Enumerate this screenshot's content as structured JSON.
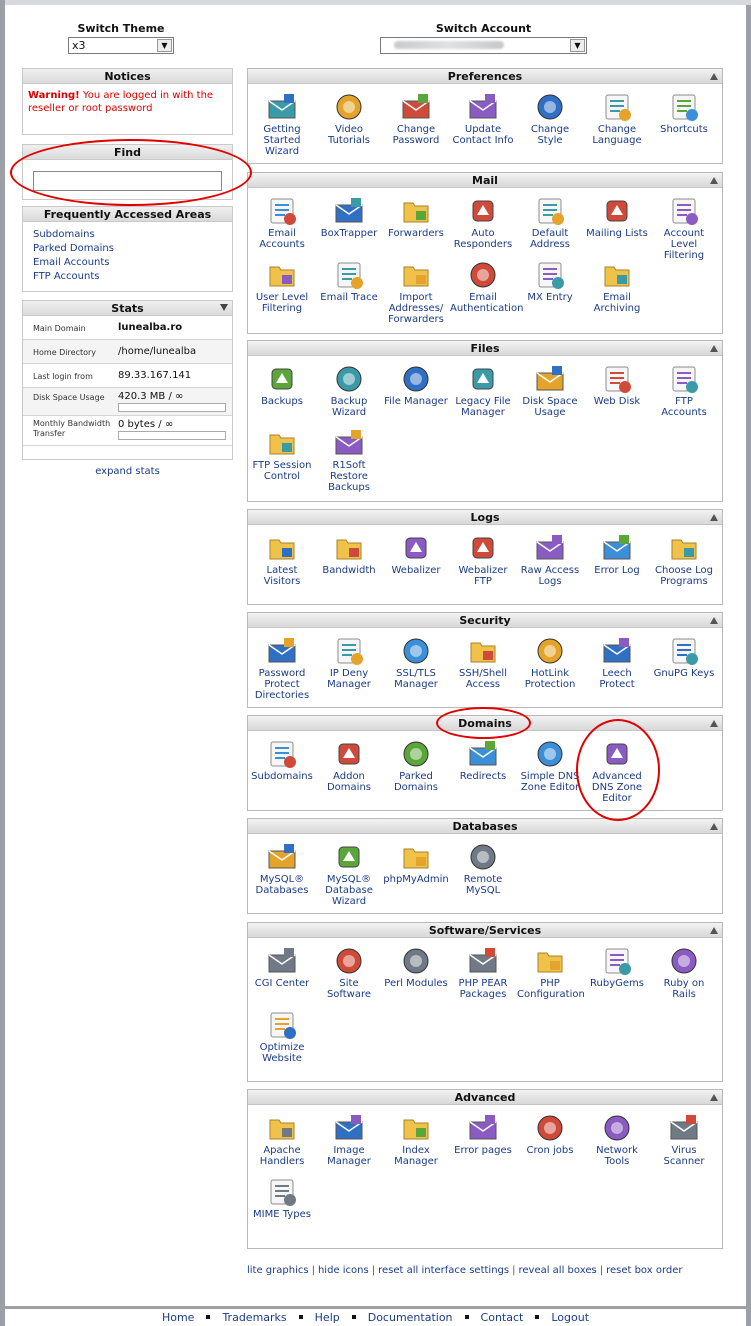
{
  "switch_theme": {
    "label": "Switch Theme",
    "value": "x3"
  },
  "switch_account": {
    "label": "Switch Account",
    "value": ""
  },
  "notices": {
    "title": "Notices",
    "warning_bold": "Warning!",
    "warning_text": " You are logged in with the reseller or root password"
  },
  "find": {
    "title": "Find",
    "value": ""
  },
  "faa": {
    "title": "Frequently Accessed Areas",
    "links": [
      "Subdomains",
      "Parked Domains",
      "Email Accounts",
      "FTP Accounts"
    ]
  },
  "stats": {
    "title": "Stats",
    "rows": [
      {
        "key": "Main Domain",
        "value": "lunealba.ro"
      },
      {
        "key": "Home Directory",
        "value": "/home/lunealba"
      },
      {
        "key": "Last login from",
        "value": "89.33.167.141"
      },
      {
        "key": "Disk Space Usage",
        "value": "420.3 MB / ∞"
      },
      {
        "key": "Monthly Bandwidth Transfer",
        "value": "0 bytes / ∞"
      }
    ],
    "expand": "expand stats"
  },
  "sections": [
    {
      "title": "Preferences",
      "items": [
        "Getting Started Wizard",
        "Video Tutorials",
        "Change Password",
        "Update Contact Info",
        "Change Style",
        "Change Language",
        "Shortcuts"
      ]
    },
    {
      "title": "Mail",
      "items": [
        "Email Accounts",
        "BoxTrapper",
        "Forwarders",
        "Auto Responders",
        "Default Address",
        "Mailing Lists",
        "Account Level Filtering",
        "User Level Filtering",
        "Email Trace",
        "Import Addresses/ Forwarders",
        "Email Authentication",
        "MX Entry",
        "Email Archiving"
      ]
    },
    {
      "title": "Files",
      "items": [
        "Backups",
        "Backup Wizard",
        "File Manager",
        "Legacy File Manager",
        "Disk Space Usage",
        "Web Disk",
        "FTP Accounts",
        "FTP Session Control",
        "R1Soft Restore Backups"
      ]
    },
    {
      "title": "Logs",
      "items": [
        "Latest Visitors",
        "Bandwidth",
        "Webalizer",
        "Webalizer FTP",
        "Raw Access Logs",
        "Error Log",
        "Choose Log Programs"
      ]
    },
    {
      "title": "Security",
      "items": [
        "Password Protect Directories",
        "IP Deny Manager",
        "SSL/TLS Manager",
        "SSH/Shell Access",
        "HotLink Protection",
        "Leech Protect",
        "GnuPG Keys"
      ]
    },
    {
      "title": "Domains",
      "items": [
        "Subdomains",
        "Addon Domains",
        "Parked Domains",
        "Redirects",
        "Simple DNS Zone Editor",
        "Advanced DNS Zone Editor"
      ]
    },
    {
      "title": "Databases",
      "items": [
        "MySQL® Databases",
        "MySQL® Database Wizard",
        "phpMyAdmin",
        "Remote MySQL"
      ]
    },
    {
      "title": "Software/Services",
      "items": [
        "CGI Center",
        "Site Software",
        "Perl Modules",
        "PHP PEAR Packages",
        "PHP Configuration",
        "RubyGems",
        "Ruby on Rails",
        "Optimize Website"
      ]
    },
    {
      "title": "Advanced",
      "items": [
        "Apache Handlers",
        "Image Manager",
        "Index Manager",
        "Error pages",
        "Cron jobs",
        "Network Tools",
        "Virus Scanner",
        "MIME Types"
      ]
    }
  ],
  "bottom_links": [
    "lite graphics",
    "hide icons",
    "reset all interface settings",
    "reveal all boxes",
    "reset box order"
  ],
  "footer": [
    "Home",
    "Trademarks",
    "Help",
    "Documentation",
    "Contact",
    "Logout"
  ]
}
